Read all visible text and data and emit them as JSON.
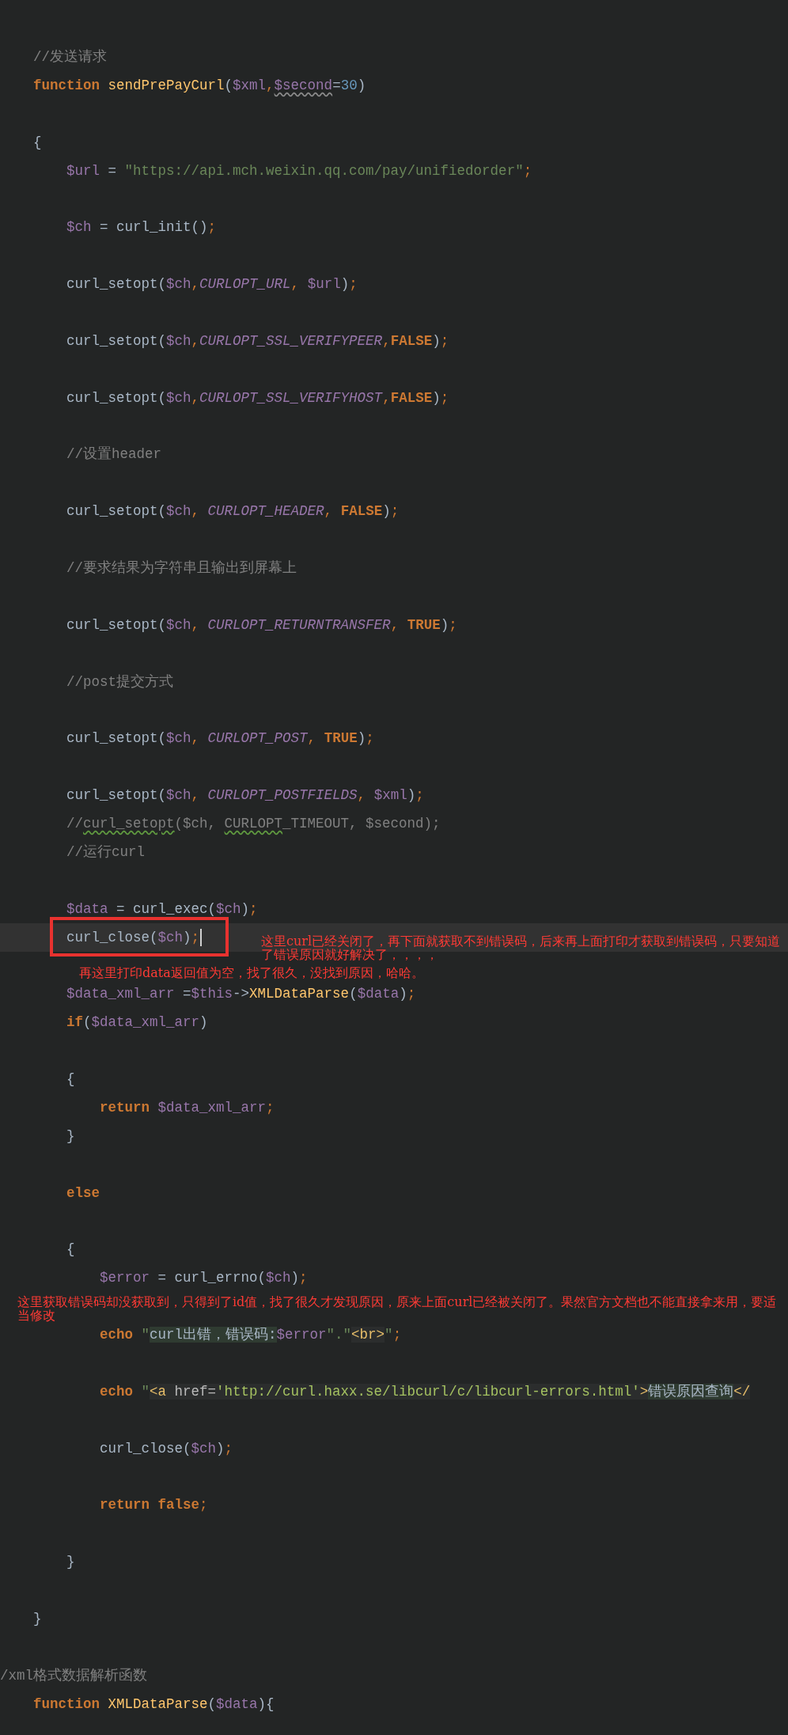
{
  "editor": {
    "rows": [
      {
        "kind": "code",
        "current": false,
        "tokens": [
          {
            "kind": "com",
            "text": "    //发送请求"
          }
        ]
      },
      {
        "kind": "code",
        "current": false,
        "tokens": [
          {
            "kind": "kw",
            "text": "    function "
          },
          {
            "kind": "fn",
            "text": "sendPrePayCurl"
          },
          {
            "kind": "p",
            "text": "("
          },
          {
            "kind": "var",
            "text": "$xml"
          },
          {
            "kind": "semi",
            "text": ","
          },
          {
            "kind": "varw",
            "text": "$second"
          },
          {
            "kind": "p",
            "text": "="
          },
          {
            "kind": "num",
            "text": "30"
          },
          {
            "kind": "p",
            "text": ")"
          }
        ]
      },
      {
        "kind": "blank"
      },
      {
        "kind": "code",
        "current": false,
        "tokens": [
          {
            "kind": "p",
            "text": "    {"
          }
        ]
      },
      {
        "kind": "code",
        "current": false,
        "tokens": [
          {
            "kind": "var",
            "text": "        $url"
          },
          {
            "kind": "p",
            "text": " = "
          },
          {
            "kind": "str",
            "text": "\"https://api.mch.weixin.qq.com/pay/unifiedorder\""
          },
          {
            "kind": "semi",
            "text": ";"
          }
        ]
      },
      {
        "kind": "blank"
      },
      {
        "kind": "code",
        "current": false,
        "tokens": [
          {
            "kind": "var",
            "text": "        $ch"
          },
          {
            "kind": "p",
            "text": " = curl_init()"
          },
          {
            "kind": "semi",
            "text": ";"
          }
        ]
      },
      {
        "kind": "blank"
      },
      {
        "kind": "code",
        "current": false,
        "tokens": [
          {
            "kind": "p",
            "text": "        curl_setopt("
          },
          {
            "kind": "var",
            "text": "$ch"
          },
          {
            "kind": "semi",
            "text": ","
          },
          {
            "kind": "const",
            "text": "CURLOPT_URL"
          },
          {
            "kind": "semi",
            "text": ", "
          },
          {
            "kind": "var",
            "text": "$url"
          },
          {
            "kind": "p",
            "text": ")"
          },
          {
            "kind": "semi",
            "text": ";"
          }
        ]
      },
      {
        "kind": "blank"
      },
      {
        "kind": "code",
        "current": false,
        "tokens": [
          {
            "kind": "p",
            "text": "        curl_setopt("
          },
          {
            "kind": "var",
            "text": "$ch"
          },
          {
            "kind": "semi",
            "text": ","
          },
          {
            "kind": "const",
            "text": "CURLOPT_SSL_VERIFYPEER"
          },
          {
            "kind": "semi",
            "text": ","
          },
          {
            "kind": "kw",
            "text": "FALSE"
          },
          {
            "kind": "p",
            "text": ")"
          },
          {
            "kind": "semi",
            "text": ";"
          }
        ]
      },
      {
        "kind": "blank"
      },
      {
        "kind": "code",
        "current": false,
        "tokens": [
          {
            "kind": "p",
            "text": "        curl_setopt("
          },
          {
            "kind": "var",
            "text": "$ch"
          },
          {
            "kind": "semi",
            "text": ","
          },
          {
            "kind": "const",
            "text": "CURLOPT_SSL_VERIFYHOST"
          },
          {
            "kind": "semi",
            "text": ","
          },
          {
            "kind": "kw",
            "text": "FALSE"
          },
          {
            "kind": "p",
            "text": ")"
          },
          {
            "kind": "semi",
            "text": ";"
          }
        ]
      },
      {
        "kind": "blank"
      },
      {
        "kind": "code",
        "current": false,
        "tokens": [
          {
            "kind": "com",
            "text": "        //设置header"
          }
        ]
      },
      {
        "kind": "blank"
      },
      {
        "kind": "code",
        "current": false,
        "tokens": [
          {
            "kind": "p",
            "text": "        curl_setopt("
          },
          {
            "kind": "var",
            "text": "$ch"
          },
          {
            "kind": "semi",
            "text": ", "
          },
          {
            "kind": "const",
            "text": "CURLOPT_HEADER"
          },
          {
            "kind": "semi",
            "text": ", "
          },
          {
            "kind": "kw",
            "text": "FALSE"
          },
          {
            "kind": "p",
            "text": ")"
          },
          {
            "kind": "semi",
            "text": ";"
          }
        ]
      },
      {
        "kind": "blank"
      },
      {
        "kind": "code",
        "current": false,
        "tokens": [
          {
            "kind": "com",
            "text": "        //要求结果为字符串且输出到屏幕上"
          }
        ]
      },
      {
        "kind": "blank"
      },
      {
        "kind": "code",
        "current": false,
        "tokens": [
          {
            "kind": "p",
            "text": "        curl_setopt("
          },
          {
            "kind": "var",
            "text": "$ch"
          },
          {
            "kind": "semi",
            "text": ", "
          },
          {
            "kind": "const",
            "text": "CURLOPT_RETURNTRANSFER"
          },
          {
            "kind": "semi",
            "text": ", "
          },
          {
            "kind": "kw",
            "text": "TRUE"
          },
          {
            "kind": "p",
            "text": ")"
          },
          {
            "kind": "semi",
            "text": ";"
          }
        ]
      },
      {
        "kind": "blank"
      },
      {
        "kind": "code",
        "current": false,
        "tokens": [
          {
            "kind": "com",
            "text": "        //post提交方式"
          }
        ]
      },
      {
        "kind": "blank"
      },
      {
        "kind": "code",
        "current": false,
        "tokens": [
          {
            "kind": "p",
            "text": "        curl_setopt("
          },
          {
            "kind": "var",
            "text": "$ch"
          },
          {
            "kind": "semi",
            "text": ", "
          },
          {
            "kind": "const",
            "text": "CURLOPT_POST"
          },
          {
            "kind": "semi",
            "text": ", "
          },
          {
            "kind": "kw",
            "text": "TRUE"
          },
          {
            "kind": "p",
            "text": ")"
          },
          {
            "kind": "semi",
            "text": ";"
          }
        ]
      },
      {
        "kind": "blank"
      },
      {
        "kind": "code",
        "current": false,
        "tokens": [
          {
            "kind": "p",
            "text": "        curl_setopt("
          },
          {
            "kind": "var",
            "text": "$ch"
          },
          {
            "kind": "semi",
            "text": ", "
          },
          {
            "kind": "const",
            "text": "CURLOPT_POSTFIELDS"
          },
          {
            "kind": "semi",
            "text": ", "
          },
          {
            "kind": "var",
            "text": "$xml"
          },
          {
            "kind": "p",
            "text": ")"
          },
          {
            "kind": "semi",
            "text": ";"
          }
        ]
      },
      {
        "kind": "code",
        "current": false,
        "tokens": [
          {
            "kind": "com",
            "text": "        //"
          },
          {
            "kind": "comw",
            "text": "curl_setopt"
          },
          {
            "kind": "com",
            "text": "($ch, "
          },
          {
            "kind": "comw",
            "text": "CURLOPT"
          },
          {
            "kind": "com",
            "text": "_TIMEOUT, $second);"
          }
        ]
      },
      {
        "kind": "code",
        "current": false,
        "tokens": [
          {
            "kind": "com",
            "text": "        //运行curl"
          }
        ]
      },
      {
        "kind": "blank"
      },
      {
        "kind": "code",
        "current": false,
        "tokens": [
          {
            "kind": "var",
            "text": "        $data"
          },
          {
            "kind": "p",
            "text": " = curl_exec("
          },
          {
            "kind": "var",
            "text": "$ch"
          },
          {
            "kind": "p",
            "text": ")"
          },
          {
            "kind": "semi",
            "text": ";"
          }
        ]
      },
      {
        "kind": "code",
        "current": true,
        "tokens": [
          {
            "kind": "p",
            "text": "        curl_close("
          },
          {
            "kind": "var",
            "text": "$ch"
          },
          {
            "kind": "p",
            "text": ")"
          },
          {
            "kind": "semi",
            "text": ";"
          }
        ],
        "annotation": {
          "text": "这里curl已经关闭了，再下面就获取不到错误码，后来再上面打印才获取到错误码，只要知道了错误原因就好解决了，，，，",
          "framed": true
        }
      },
      {
        "kind": "note",
        "text": "再这里打印data返回值为空，找了很久，没找到原因，哈哈。"
      },
      {
        "kind": "code",
        "current": false,
        "tokens": [
          {
            "kind": "var",
            "text": "        $data_xml_arr"
          },
          {
            "kind": "p",
            "text": " ="
          },
          {
            "kind": "var",
            "text": "$this"
          },
          {
            "kind": "p",
            "text": "->"
          },
          {
            "kind": "fn",
            "text": "XMLDataParse"
          },
          {
            "kind": "p",
            "text": "("
          },
          {
            "kind": "var",
            "text": "$data"
          },
          {
            "kind": "p",
            "text": ")"
          },
          {
            "kind": "semi",
            "text": ";"
          }
        ]
      },
      {
        "kind": "code",
        "current": false,
        "tokens": [
          {
            "kind": "kw",
            "text": "        if"
          },
          {
            "kind": "p",
            "text": "("
          },
          {
            "kind": "var",
            "text": "$data_xml_arr"
          },
          {
            "kind": "p",
            "text": ")"
          }
        ]
      },
      {
        "kind": "blank"
      },
      {
        "kind": "code",
        "current": false,
        "tokens": [
          {
            "kind": "p",
            "text": "        {"
          }
        ]
      },
      {
        "kind": "code",
        "current": false,
        "tokens": [
          {
            "kind": "kw",
            "text": "            return "
          },
          {
            "kind": "var",
            "text": "$data_xml_arr"
          },
          {
            "kind": "semi",
            "text": ";"
          }
        ]
      },
      {
        "kind": "code",
        "current": false,
        "tokens": [
          {
            "kind": "p",
            "text": "        }"
          }
        ]
      },
      {
        "kind": "blank"
      },
      {
        "kind": "code",
        "current": false,
        "tokens": [
          {
            "kind": "kw",
            "text": "        else"
          }
        ]
      },
      {
        "kind": "blank"
      },
      {
        "kind": "code",
        "current": false,
        "tokens": [
          {
            "kind": "p",
            "text": "        {"
          }
        ]
      },
      {
        "kind": "code",
        "current": false,
        "tokens": [
          {
            "kind": "var",
            "text": "            $error"
          },
          {
            "kind": "p",
            "text": " = curl_errno("
          },
          {
            "kind": "var",
            "text": "$ch"
          },
          {
            "kind": "p",
            "text": ")"
          },
          {
            "kind": "semi",
            "text": ";"
          }
        ]
      },
      {
        "kind": "note",
        "text": "这里获取错误码却没获取到，只得到了id值，找了很久才发现原因，原来上面curl已经被关闭了。果然官方文档也不能直接拿来用，要适当修改"
      },
      {
        "kind": "code",
        "current": false,
        "tokens": [
          {
            "kind": "kw",
            "text": "            echo "
          },
          {
            "kind": "str",
            "text": "\""
          },
          {
            "kind": "ihl",
            "text": "curl出错，错误码:"
          },
          {
            "kind": "var",
            "text": "$error"
          },
          {
            "kind": "str",
            "text": "\".\""
          },
          {
            "kind": "tag",
            "text": "<br>"
          },
          {
            "kind": "str",
            "text": "\""
          },
          {
            "kind": "semi",
            "text": ";"
          }
        ]
      },
      {
        "kind": "blank"
      },
      {
        "kind": "code",
        "current": false,
        "tokens": [
          {
            "kind": "kw",
            "text": "            echo "
          },
          {
            "kind": "str",
            "text": "\""
          },
          {
            "kind": "tag",
            "text": "<a"
          },
          {
            "kind": "attr",
            "text": " href="
          },
          {
            "kind": "aval",
            "text": "'http://curl.haxx.se/libcurl/c/libcurl-errors.html'"
          },
          {
            "kind": "tag",
            "text": ">"
          },
          {
            "kind": "ihl",
            "text": "错误原因查询"
          },
          {
            "kind": "tag",
            "text": "</"
          }
        ]
      },
      {
        "kind": "blank"
      },
      {
        "kind": "code",
        "current": false,
        "tokens": [
          {
            "kind": "p",
            "text": "            curl_close("
          },
          {
            "kind": "var",
            "text": "$ch"
          },
          {
            "kind": "p",
            "text": ")"
          },
          {
            "kind": "semi",
            "text": ";"
          }
        ]
      },
      {
        "kind": "blank"
      },
      {
        "kind": "code",
        "current": false,
        "tokens": [
          {
            "kind": "kw",
            "text": "            return false"
          },
          {
            "kind": "semi",
            "text": ";"
          }
        ]
      },
      {
        "kind": "blank"
      },
      {
        "kind": "code",
        "current": false,
        "tokens": [
          {
            "kind": "p",
            "text": "        }"
          }
        ]
      },
      {
        "kind": "blank"
      },
      {
        "kind": "code",
        "current": false,
        "tokens": [
          {
            "kind": "p",
            "text": "    }"
          }
        ]
      },
      {
        "kind": "blank"
      },
      {
        "kind": "code",
        "current": false,
        "tokens": [
          {
            "kind": "com",
            "text": "/xml格式数据解析函数"
          }
        ]
      },
      {
        "kind": "code",
        "current": false,
        "tokens": [
          {
            "kind": "kw",
            "text": "    function "
          },
          {
            "kind": "fn",
            "text": "XMLDataParse"
          },
          {
            "kind": "p",
            "text": "("
          },
          {
            "kind": "var",
            "text": "$data"
          },
          {
            "kind": "p",
            "text": "){"
          }
        ]
      }
    ]
  }
}
